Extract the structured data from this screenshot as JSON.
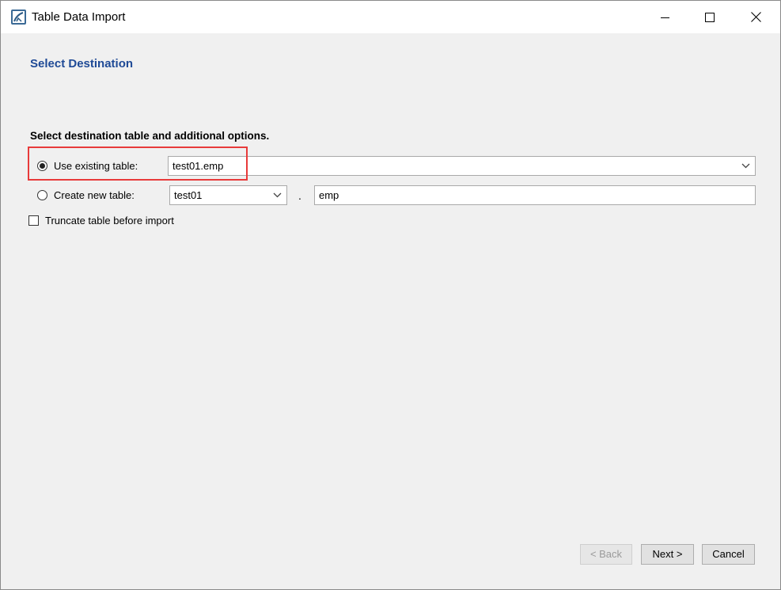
{
  "window": {
    "title": "Table Data Import",
    "app_icon": "mysql-workbench-icon"
  },
  "page": {
    "heading": "Select Destination",
    "section_label": "Select destination table and additional options."
  },
  "options": {
    "use_existing": {
      "label": "Use existing table:",
      "selected": true,
      "value": "test01.emp"
    },
    "create_new": {
      "label": "Create new table:",
      "selected": false,
      "schema_value": "test01",
      "separator": ".",
      "table_value": "emp"
    },
    "truncate": {
      "label": "Truncate table before import",
      "checked": false
    }
  },
  "buttons": {
    "back": "< Back",
    "next": "Next >",
    "cancel": "Cancel"
  },
  "colors": {
    "heading": "#1f4a96",
    "highlight": "#e83a3a"
  }
}
